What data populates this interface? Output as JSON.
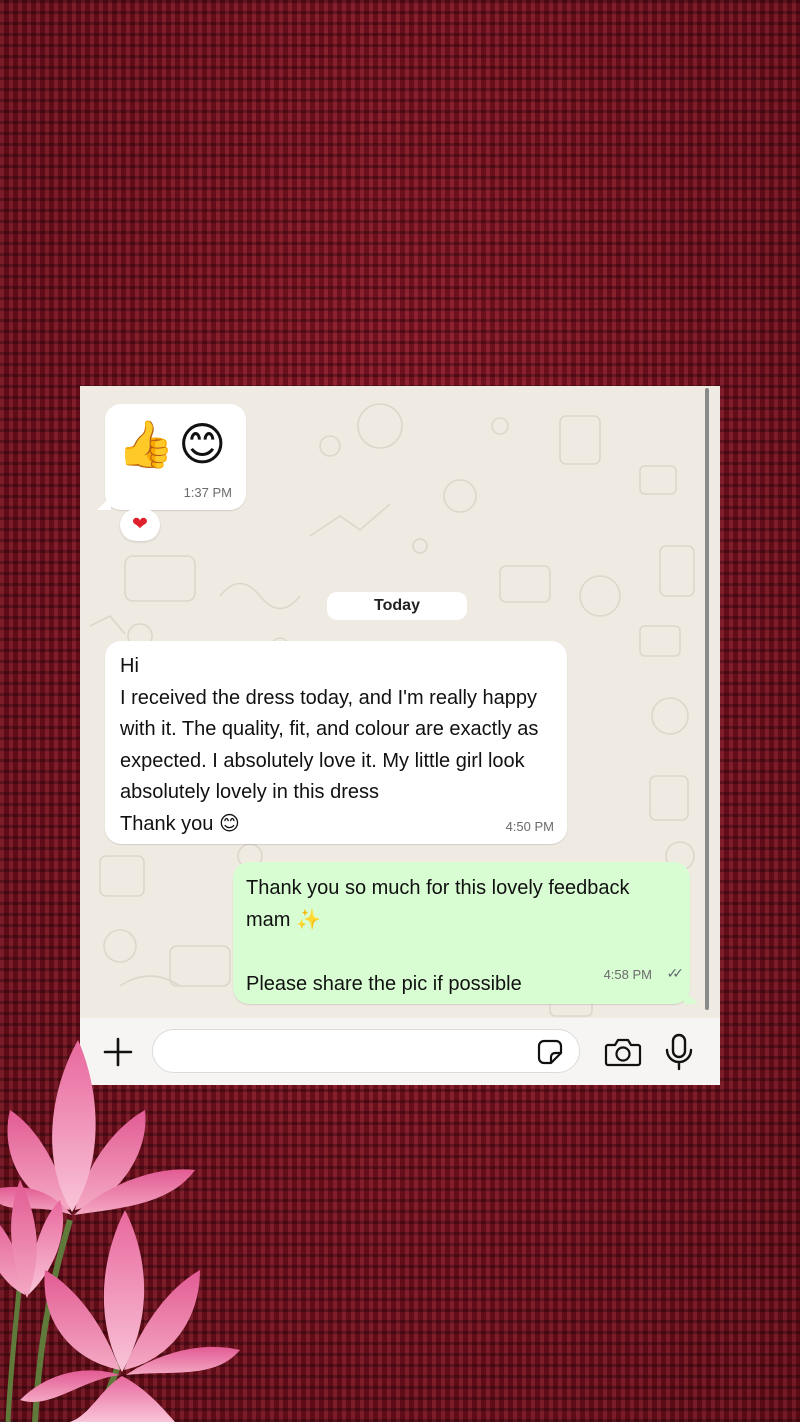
{
  "colors": {
    "background": "#7a0f1e",
    "chat_wallpaper": "#efeae2",
    "incoming_bubble": "#ffffff",
    "outgoing_bubble": "#d9fdd3",
    "timestamp": "#6b6b6b",
    "read_ticks": "#5d6a6f"
  },
  "icons": {
    "plus": "plus-icon",
    "sticker": "sticker-icon",
    "camera": "camera-icon",
    "mic": "microphone-icon",
    "read_receipt": "double-check-icon",
    "reaction": "heart-icon"
  },
  "chat": {
    "messages": [
      {
        "direction": "incoming",
        "text": "👍😊",
        "time": "1:37 PM",
        "reaction": "❤"
      },
      {
        "direction": "incoming",
        "text": "Hi\n I received the  dress today, and I'm really happy with it. The quality, fit, and colour are exactly as expected. I absolutely love it. My little girl look absolutely lovely in this dress\nThank you 😊",
        "time": "4:50 PM"
      },
      {
        "direction": "outgoing",
        "text": "Thank you so much for this lovely feedback mam ✨\n\nPlease share the pic if possible",
        "time": "4:58 PM",
        "ticks": "✓✓"
      }
    ],
    "date_separator": "Today"
  },
  "input_bar": {
    "message_value": "",
    "message_placeholder": ""
  }
}
